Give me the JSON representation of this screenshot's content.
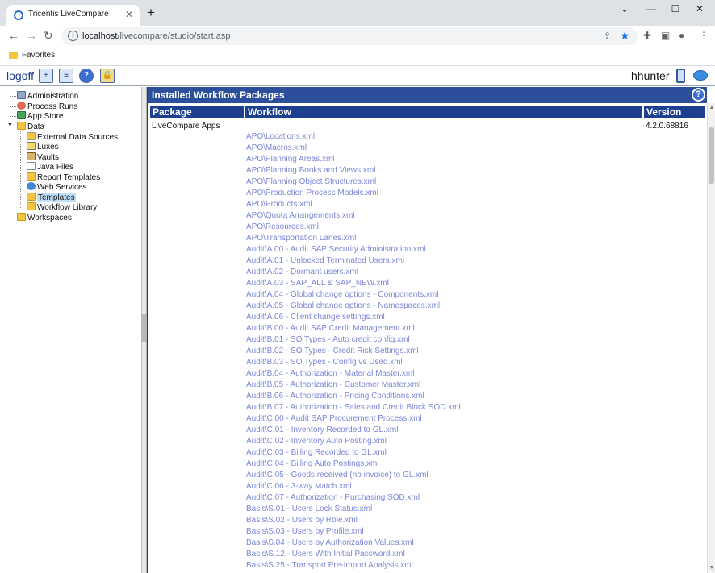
{
  "browser": {
    "tab_title": "Tricentis LiveCompare",
    "close_tab_glyph": "✕",
    "new_tab_glyph": "+",
    "url_host": "localhost",
    "url_path": "/livecompare/studio/start.asp",
    "favorites_label": "Favorites",
    "icons": [
      "back-icon",
      "forward-icon",
      "reload-icon",
      "info-icon",
      "share-icon",
      "star-icon",
      "extensions-icon",
      "sidepanel-icon",
      "profile-icon",
      "menu-icon"
    ]
  },
  "header": {
    "logoff_label": "logoff",
    "username": "hhunter",
    "icons": [
      "new-window-icon",
      "server-icon",
      "help-icon",
      "lock-icon",
      "mobile-icon",
      "chat-icon"
    ]
  },
  "tree": {
    "items": [
      {
        "label": "Administration",
        "icon": "administration-icon"
      },
      {
        "label": "Process Runs",
        "icon": "process-runs-icon"
      },
      {
        "label": "App Store",
        "icon": "app-store-icon"
      },
      {
        "label": "Data",
        "icon": "folder-icon"
      },
      {
        "label": "External Data Sources",
        "icon": "external-data-icon"
      },
      {
        "label": "Luxes",
        "icon": "luxes-icon"
      },
      {
        "label": "Vaults",
        "icon": "vault-icon"
      },
      {
        "label": "Java Files",
        "icon": "java-file-icon"
      },
      {
        "label": "Report Templates",
        "icon": "folder-icon"
      },
      {
        "label": "Web Services",
        "icon": "web-services-icon"
      },
      {
        "label": "Templates",
        "icon": "folder-icon",
        "selected": true
      },
      {
        "label": "Workflow Library",
        "icon": "folder-icon"
      },
      {
        "label": "Workspaces",
        "icon": "folder-icon"
      }
    ]
  },
  "panel": {
    "title": "Installed Workflow Packages",
    "columns": {
      "package": "Package",
      "workflow": "Workflow",
      "version": "Version"
    },
    "package_name": "LiveCompare Apps",
    "package_version": "4.2.0.68816",
    "workflows": [
      "APO\\Locations.xml",
      "APO\\Macros.xml",
      "APO\\Planning Areas.xml",
      "APO\\Planning Books and Views.xml",
      "APO\\Planning Object Structures.xml",
      "APO\\Production Process Models.xml",
      "APO\\Products.xml",
      "APO\\Quota Arrangements.xml",
      "APO\\Resources.xml",
      "APO\\Transportation Lanes.xml",
      "Audit\\A.00 - Audit SAP Security Administration.xml",
      "Audit\\A.01 - Unlocked Terminated Users.xml",
      "Audit\\A.02 - Dormant users.xml",
      "Audit\\A.03 - SAP_ALL & SAP_NEW.xml",
      "Audit\\A.04 - Global change options - Components.xml",
      "Audit\\A.05 - Global change options - Namespaces.xml",
      "Audit\\A.06 - Client change settings.xml",
      "Audit\\B.00 - Audit SAP Credit Management.xml",
      "Audit\\B.01 - SO Types - Auto credit config.xml",
      "Audit\\B.02 - SO Types - Credit Risk Settings.xml",
      "Audit\\B.03 - SO Types - Config vs Used.xml",
      "Audit\\B.04 - Authorization - Material Master.xml",
      "Audit\\B.05 - Authorization - Customer Master.xml",
      "Audit\\B.06 - Authorization - Pricing Conditions.xml",
      "Audit\\B.07 - Authorization - Sales and Credit Block SOD.xml",
      "Audit\\C.00 - Audit SAP Procurement Process.xml",
      "Audit\\C.01 - Inventory Recorded to GL.xml",
      "Audit\\C.02 - Inventory Auto Posting.xml",
      "Audit\\C.03 - Billing Recorded to GL.xml",
      "Audit\\C.04 - Billing Auto Postings.xml",
      "Audit\\C.05 - Goods received (no invoice) to GL.xml",
      "Audit\\C.06 - 3-way Match.xml",
      "Audit\\C.07 - Authorization - Purchasing SOD.xml",
      "Basis\\S.01 - Users Lock Status.xml",
      "Basis\\S.02 - Users by Role.xml",
      "Basis\\S.03 - Users by Profile.xml",
      "Basis\\S.04 - Users by Authorization Values.xml",
      "Basis\\S.12 - Users With Initial Password.xml",
      "Basis\\S.25 - Transport Pre-Import Analysis.xml"
    ]
  }
}
